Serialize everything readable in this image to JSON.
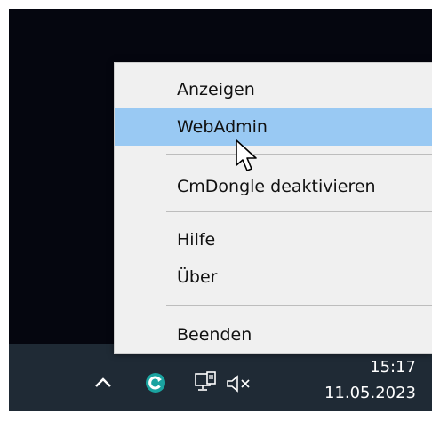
{
  "context_menu": {
    "items": [
      {
        "label": "Anzeigen"
      },
      {
        "label": "WebAdmin"
      },
      {
        "label": "CmDongle deaktivieren"
      },
      {
        "label": "Hilfe"
      },
      {
        "label": "Über"
      },
      {
        "label": "Beenden"
      }
    ]
  },
  "taskbar": {
    "time": "15:17",
    "date": "11.05.2023",
    "icons": [
      "chevron-up-icon",
      "codemeter-icon",
      "network-icon",
      "volume-muted-icon"
    ]
  },
  "colors": {
    "desktop": "#05060f",
    "taskbar": "#1f2a35",
    "menu_bg": "#f0f0f0",
    "highlight": "#99c9f3"
  }
}
